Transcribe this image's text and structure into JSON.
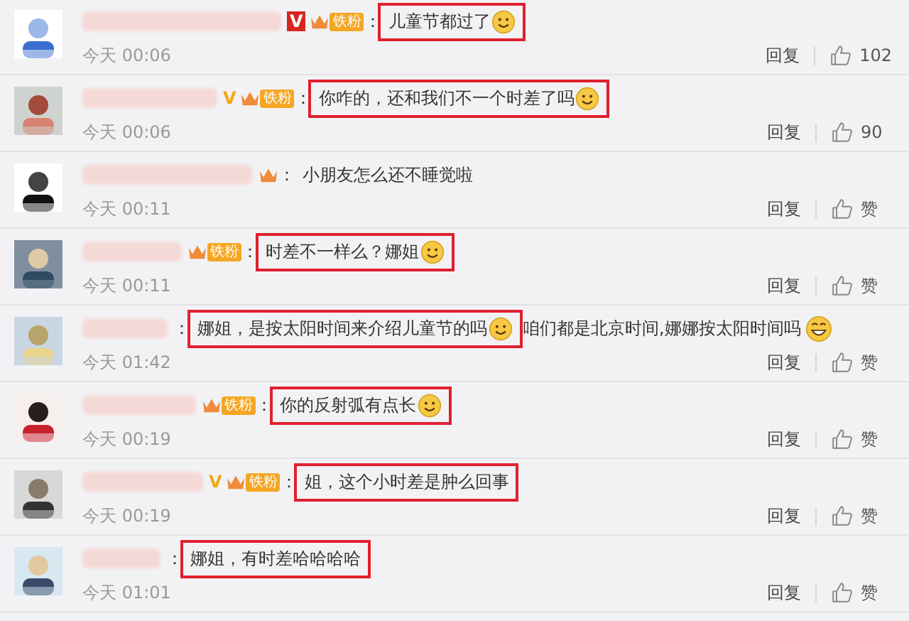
{
  "comments": [
    {
      "vip": {
        "label": "V",
        "kind": "red"
      },
      "crown": true,
      "badge": "铁粉",
      "colon": "：",
      "boxed": true,
      "text": "儿童节都过了",
      "emoji": true,
      "time": "今天 00:06",
      "reply": "回复",
      "likes": "102"
    },
    {
      "vip": {
        "label": "V",
        "kind": "gold"
      },
      "crown": true,
      "badge": "铁粉",
      "colon": "：",
      "boxed": true,
      "text": "你咋的，还和我们不一个时差了吗",
      "emoji": true,
      "time": "今天 00:06",
      "reply": "回复",
      "likes": "90"
    },
    {
      "crown": true,
      "colon": "：",
      "boxed": false,
      "text": "小朋友怎么还不睡觉啦",
      "emoji": false,
      "time": "今天 00:11",
      "reply": "回复",
      "likes": "赞"
    },
    {
      "crown": true,
      "badge": "铁粉",
      "colon": "：",
      "boxed": true,
      "text": "时差不一样么？娜姐",
      "emoji": true,
      "time": "今天 00:11",
      "reply": "回复",
      "likes": "赞"
    },
    {
      "crown": false,
      "colon": "：",
      "boxed": true,
      "text": "娜姐，是按太阳时间来介绍儿童节的吗",
      "emoji": true,
      "extra": {
        "text": "咱们都是北京时间,娜娜按太阳时间吗",
        "emoji": true
      },
      "time": "今天 01:42",
      "reply": "回复",
      "likes": "赞"
    },
    {
      "crown": true,
      "badge": "铁粉",
      "colon": "：",
      "boxed": true,
      "text": "你的反射弧有点长",
      "emoji": true,
      "time": "今天 00:19",
      "reply": "回复",
      "likes": "赞"
    },
    {
      "vip": {
        "label": "V",
        "kind": "gold"
      },
      "crown": true,
      "badge": "铁粉",
      "colon": "：",
      "boxed": true,
      "text": "姐，这个小时差是肿么回事",
      "emoji": false,
      "time": "今天 00:19",
      "reply": "回复",
      "likes": "赞"
    },
    {
      "crown": false,
      "colon": "：",
      "boxed": true,
      "text": "娜姐，有时差哈哈哈哈",
      "emoji": false,
      "time": "今天 01:01",
      "reply": "回复",
      "likes": "赞"
    }
  ]
}
